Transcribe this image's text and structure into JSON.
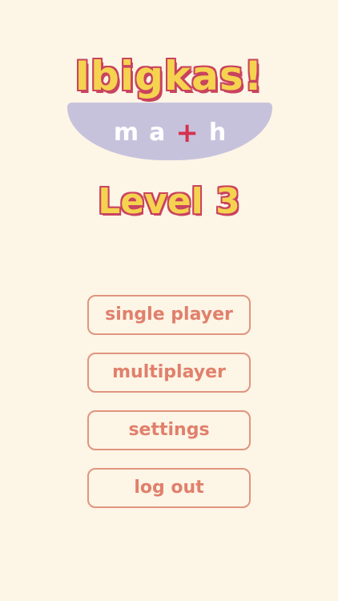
{
  "logo": {
    "title": "Ibigkas!",
    "subtitle_left": "m",
    "subtitle_a": "a",
    "subtitle_plus": "+",
    "subtitle_right": "h"
  },
  "level": {
    "label": "Level 3"
  },
  "menu": {
    "single_player": "single player",
    "multiplayer": "multiplayer",
    "settings": "settings",
    "log_out": "log out"
  },
  "colors": {
    "background": "#fdf5e6",
    "title_fill": "#f5d34f",
    "title_outline": "#c9435f",
    "banner": "#c7c2dc",
    "plus": "#d6314d",
    "button_border": "#e0957f",
    "button_text": "#e0806c"
  }
}
